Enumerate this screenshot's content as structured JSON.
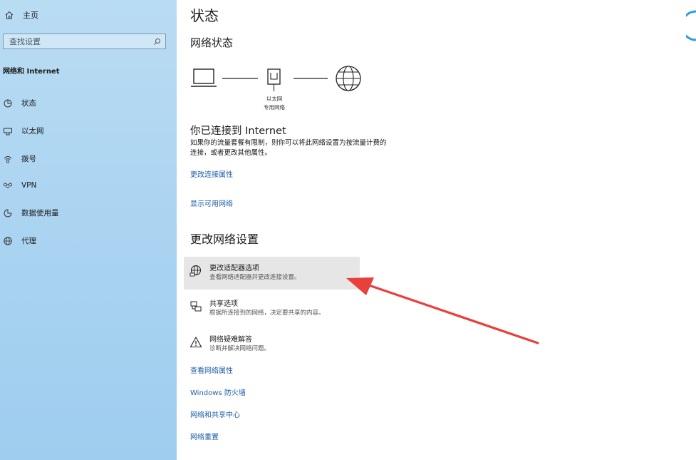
{
  "sidebar": {
    "home_label": "主页",
    "search_placeholder": "查找设置",
    "section_title": "网络和 Internet",
    "items": [
      {
        "label": "状态",
        "icon": "status-icon"
      },
      {
        "label": "以太网",
        "icon": "ethernet-icon"
      },
      {
        "label": "拨号",
        "icon": "dialup-icon"
      },
      {
        "label": "VPN",
        "icon": "vpn-icon"
      },
      {
        "label": "数据使用量",
        "icon": "data-usage-icon"
      },
      {
        "label": "代理",
        "icon": "proxy-icon"
      }
    ]
  },
  "main": {
    "title": "状态",
    "network_status_heading": "网络状态",
    "diagram": {
      "line1": "以太网",
      "line2": "专用网络"
    },
    "connected_heading": "你已连接到 Internet",
    "connected_desc_line1": "如果你的流量套餐有限制，则你可以将此网络设置为按流量计费的",
    "connected_desc_line2": "连接，或者更改其他属性。",
    "link_change_props": "更改连接属性",
    "link_show_networks": "显示可用网络",
    "change_settings_heading": "更改网络设置",
    "options": [
      {
        "title": "更改适配器选项",
        "subtitle": "查看网络适配器并更改连接设置。",
        "icon": "adapter-icon"
      },
      {
        "title": "共享选项",
        "subtitle": "根据所连接到的网络，决定要共享的内容。",
        "icon": "sharing-icon"
      },
      {
        "title": "网络疑难解答",
        "subtitle": "诊断并解决网络问题。",
        "icon": "warning-icon"
      }
    ],
    "links": [
      "查看网络属性",
      "Windows 防火墙",
      "网络和共享中心",
      "网络重置"
    ]
  },
  "colors": {
    "accent_link": "#1c5ea8",
    "annotation_arrow": "#e8403a",
    "sidebar_bg": "#a9d3f1"
  }
}
